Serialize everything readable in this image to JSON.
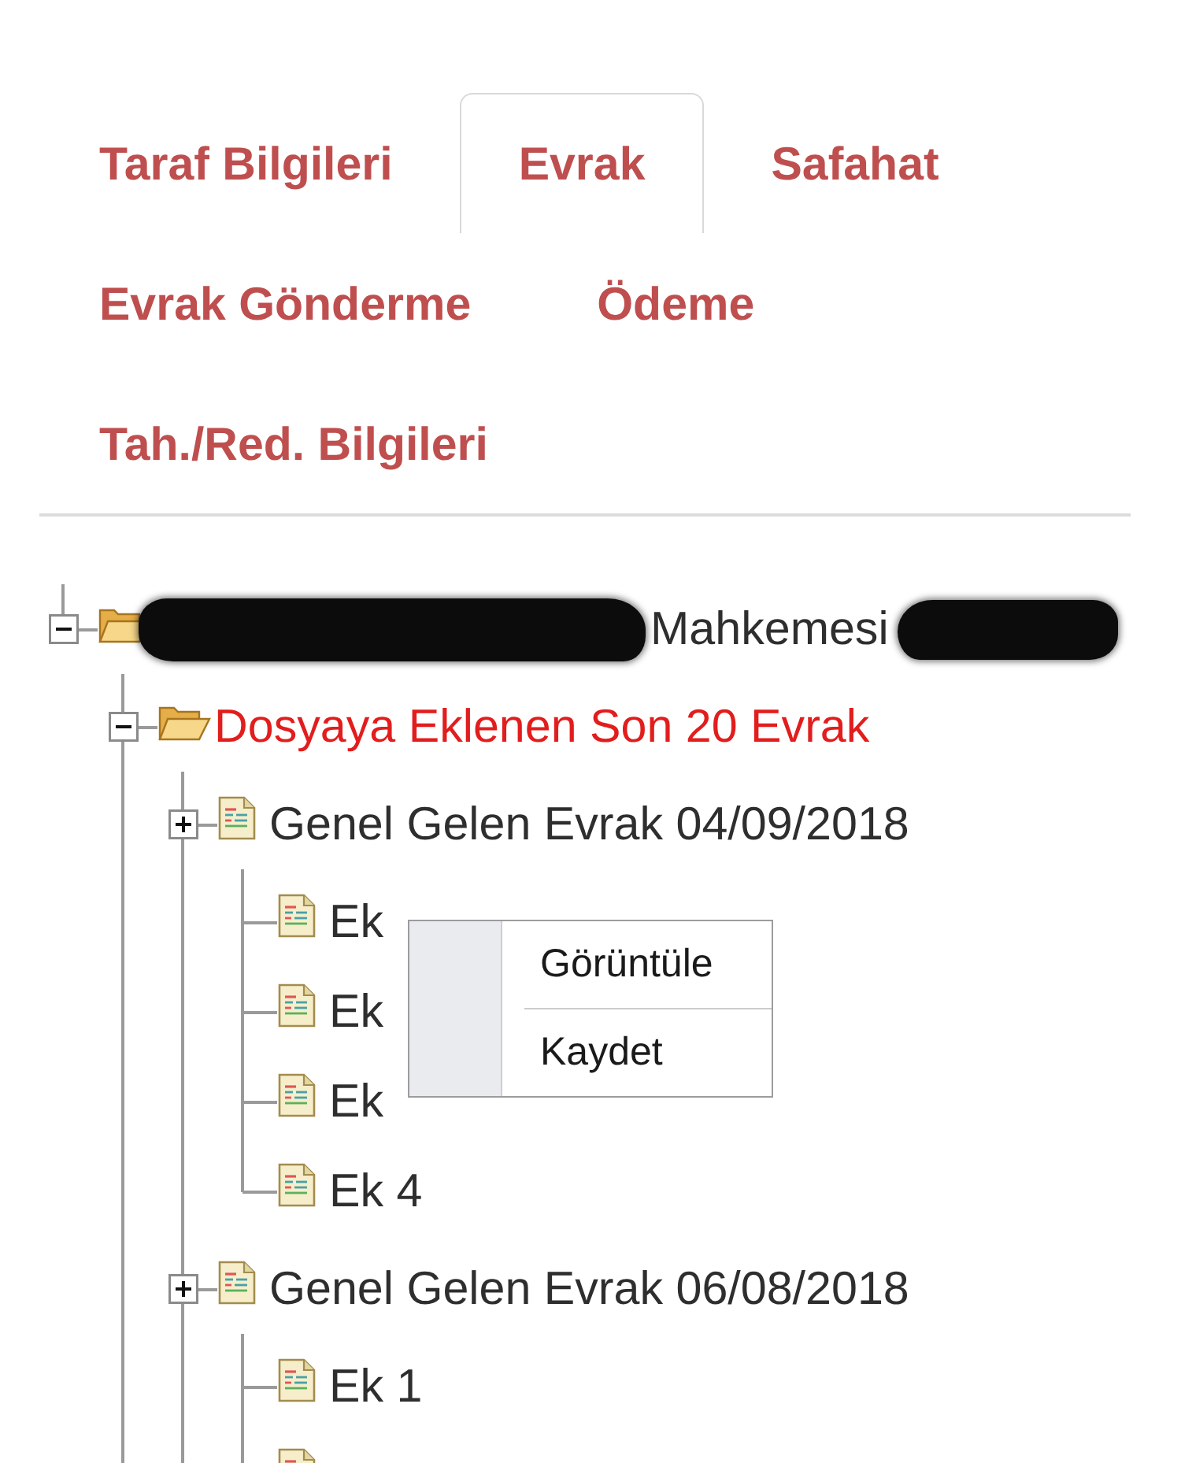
{
  "tabs": [
    {
      "label": "Taraf Bilgileri",
      "selected": false
    },
    {
      "label": "Evrak",
      "selected": true
    },
    {
      "label": "Safahat",
      "selected": false
    },
    {
      "label": "Evrak Gönderme",
      "selected": false
    },
    {
      "label": "Ödeme",
      "selected": false
    },
    {
      "label": "Tah./Red. Bilgileri",
      "selected": false
    }
  ],
  "tree": {
    "nodes": [
      {
        "kind": "folder",
        "label": "Mahkemesi",
        "redacted": true,
        "expanded": true,
        "last": true,
        "highlighted": false,
        "children": [
          {
            "kind": "folder",
            "label": "Dosyaya Eklenen Son 20 Evrak",
            "expanded": true,
            "last": false,
            "highlighted": true,
            "children": [
              {
                "kind": "document",
                "label": "Genel Gelen Evrak 04/09/2018",
                "expanded": false,
                "last": false,
                "highlighted": false,
                "children": [
                  {
                    "kind": "document",
                    "label": "Ek",
                    "last": false
                  },
                  {
                    "kind": "document",
                    "label": "Ek",
                    "last": false
                  },
                  {
                    "kind": "document",
                    "label": "Ek",
                    "last": false
                  },
                  {
                    "kind": "document",
                    "label": "Ek 4",
                    "last": true
                  }
                ]
              },
              {
                "kind": "document",
                "label": "Genel Gelen Evrak 06/08/2018",
                "expanded": false,
                "last": false,
                "highlighted": false,
                "children": [
                  {
                    "kind": "document",
                    "label": "Ek 1",
                    "last": false
                  },
                  {
                    "kind": "document"
                  }
                ]
              }
            ]
          }
        ]
      }
    ]
  },
  "context_menu": {
    "items": [
      "Görüntüle",
      "Kaydet"
    ]
  }
}
